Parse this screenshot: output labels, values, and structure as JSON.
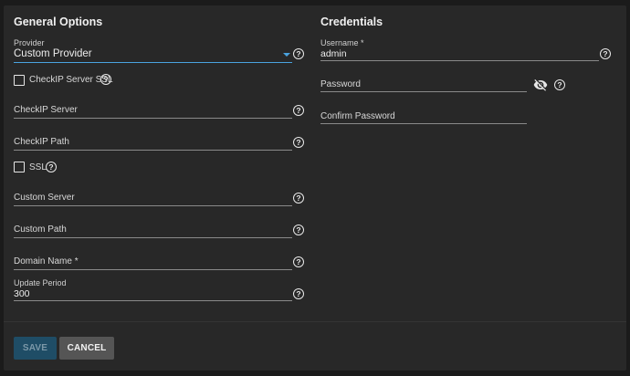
{
  "general": {
    "title": "General Options",
    "provider": {
      "label": "Provider",
      "value": "Custom Provider"
    },
    "checkip_ssl": {
      "label": "CheckIP Server SSL",
      "checked": false
    },
    "checkip_server": {
      "label": "CheckIP Server"
    },
    "checkip_path": {
      "label": "CheckIP Path"
    },
    "ssl": {
      "label": "SSL",
      "checked": false
    },
    "custom_server": {
      "label": "Custom Server"
    },
    "custom_path": {
      "label": "Custom Path"
    },
    "domain_name": {
      "label": "Domain Name *"
    },
    "update_period": {
      "label": "Update Period",
      "value": "300"
    }
  },
  "credentials": {
    "title": "Credentials",
    "username": {
      "label": "Username *",
      "value": "admin"
    },
    "password": {
      "label": "Password"
    },
    "confirm_password": {
      "label": "Confirm Password"
    }
  },
  "actions": {
    "save_label": "SAVE",
    "cancel_label": "CANCEL"
  },
  "icons": {
    "help": "help-circle-icon",
    "visibility": "eye-off-icon",
    "dropdown": "caret-down-icon"
  },
  "colors": {
    "accent": "#4aa3df",
    "save_button": "#1f4d66",
    "cancel_button": "#555555"
  }
}
